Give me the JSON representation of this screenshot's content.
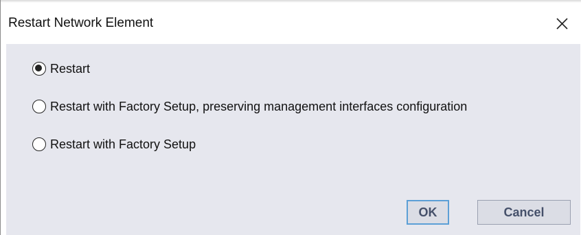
{
  "window": {
    "title": "Restart Network Element",
    "close_icon": "close-icon"
  },
  "options": [
    {
      "label": "Restart",
      "selected": true
    },
    {
      "label": "Restart with Factory Setup, preserving management interfaces configuration",
      "selected": false
    },
    {
      "label": "Restart with Factory Setup",
      "selected": false
    }
  ],
  "buttons": {
    "ok_label": "OK",
    "cancel_label": "Cancel"
  },
  "colors": {
    "dialog_background": "#e6e7ee",
    "default_button_border": "#5b9fd6",
    "button_text": "#45506a"
  }
}
